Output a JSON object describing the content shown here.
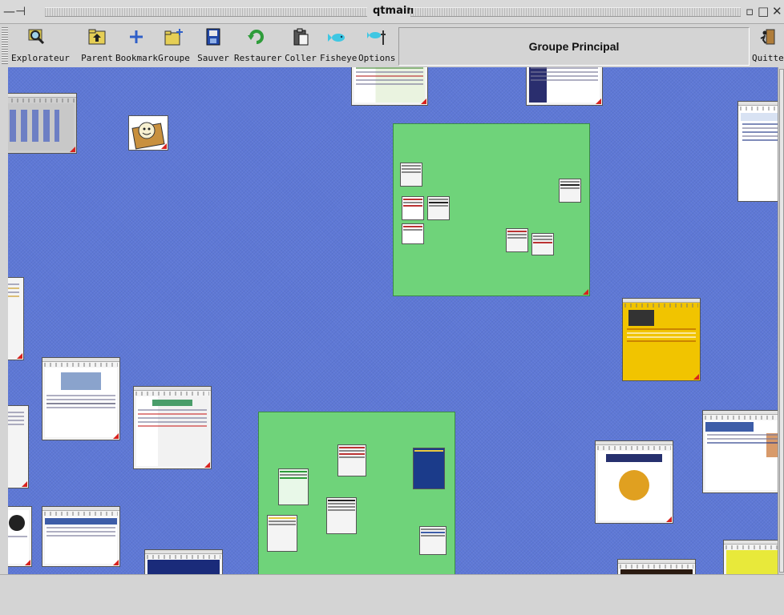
{
  "window": {
    "title": "qtmain"
  },
  "toolbar": {
    "buttons": [
      {
        "key": "explorateur",
        "label": "Explorateur",
        "icon": "magnifier-icon"
      },
      {
        "key": "parent",
        "label": "Parent",
        "icon": "folder-up-icon"
      },
      {
        "key": "bookmark",
        "label": "Bookmark",
        "icon": "plus-icon"
      },
      {
        "key": "groupe",
        "label": "Groupe",
        "icon": "new-folder-icon"
      },
      {
        "key": "sauver",
        "label": "Sauver",
        "icon": "save-icon"
      },
      {
        "key": "restaurer",
        "label": "Restaurer",
        "icon": "restore-icon"
      },
      {
        "key": "coller",
        "label": "Coller",
        "icon": "clipboard-icon"
      },
      {
        "key": "fisheye",
        "label": "Fisheye",
        "icon": "fish-icon"
      },
      {
        "key": "options",
        "label": "Options",
        "icon": "fish-options-icon"
      }
    ],
    "group_title": "Groupe Principal",
    "quit_label": "Quitter"
  },
  "colors": {
    "canvas": "#5e78d6",
    "group_panel": "#6fd37a",
    "resize_corner": "#d8231e"
  }
}
